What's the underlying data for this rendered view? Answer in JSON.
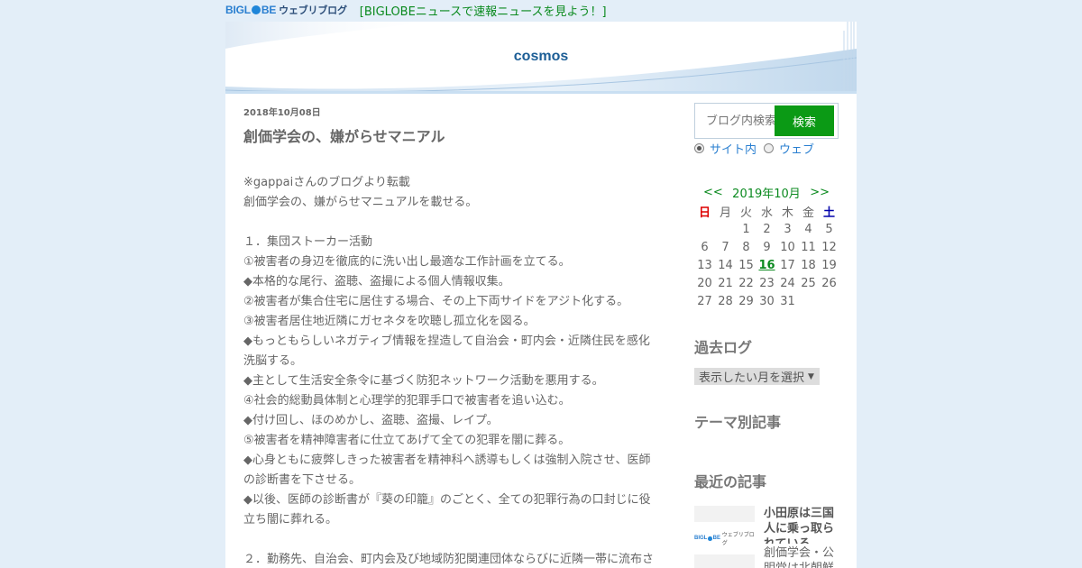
{
  "topbar": {
    "logo_big": "BIGL",
    "logo_big2": "BE",
    "logo_sub": "ウェブリブログ",
    "link": "[BIGLOBEニュースで速報ニュースを見よう！]"
  },
  "header": {
    "title": "cosmos"
  },
  "post": {
    "date": "2018年10月08日",
    "title": "創価学会の、嫌がらせマニアル",
    "lines": [
      "※gappaiさんのブログより転載",
      "創価学会の、嫌がらせマニュアルを載せる。",
      "",
      "１．集団ストーカー活動",
      "①被害者の身辺を徹底的に洗い出し最適な工作計画を立てる。",
      "◆本格的な尾行、盗聴、盗撮による個人情報収集。",
      "②被害者が集合住宅に居住する場合、その上下両サイドをアジト化する。",
      "③被害者居住地近隣にガセネタを吹聴し孤立化を図る。",
      "◆もっともらしいネガティブ情報を捏造して自治会・町内会・近隣住民を感化",
      "洗脳する。",
      "◆主として生活安全条令に基づく防犯ネットワーク活動を悪用する。",
      "④社会的総動員体制と心理学的犯罪手口で被害者を追い込む。",
      "◆付け回し、ほのめかし、盗聴、盗撮、レイプ。",
      "⑤被害者を精神障害者に仕立てあげて全ての犯罪を闇に葬る。",
      "◆心身ともに疲弊しきった被害者を精神科へ誘導もしくは強制入院させ、医師",
      "の診断書を下させる。",
      "◆以後、医師の診断書が『葵の印籠』のごとく、全ての犯罪行為の口封じに役",
      "立ち闇に葬れる。",
      "",
      "２．勤務先、自治会、町内会及び地域防犯関連団体ならびに近隣一帯に流布さ"
    ]
  },
  "sidebar": {
    "search_placeholder": "ブログ内検索",
    "search_button": "検索",
    "radio_site": "サイト内",
    "radio_web": "ウェブ",
    "calendar": {
      "prev": "<<",
      "month": "2019年10月",
      "next": ">>",
      "weekdays": [
        "日",
        "月",
        "火",
        "水",
        "木",
        "金",
        "土"
      ],
      "weeks": [
        [
          "",
          "",
          "1",
          "2",
          "3",
          "4",
          "5"
        ],
        [
          "6",
          "7",
          "8",
          "9",
          "10",
          "11",
          "12"
        ],
        [
          "13",
          "14",
          "15",
          "16",
          "17",
          "18",
          "19"
        ],
        [
          "20",
          "21",
          "22",
          "23",
          "24",
          "25",
          "26"
        ],
        [
          "27",
          "28",
          "29",
          "30",
          "31",
          "",
          ""
        ]
      ],
      "linked_day": "16"
    },
    "archive_heading": "過去ログ",
    "archive_select": "表示したい月を選択",
    "theme_heading": "テーマ別記事",
    "recent_heading": "最近の記事",
    "recent_title1": "小田原は三国人に乗っ取られている",
    "recent_title2": "創価学会・公明党は北朝鮮"
  },
  "colors": {
    "accent_green": "#0b9a15",
    "link_blue": "#2a7fd0",
    "title_blue": "#1c5e96",
    "background": "#e3eef8"
  }
}
